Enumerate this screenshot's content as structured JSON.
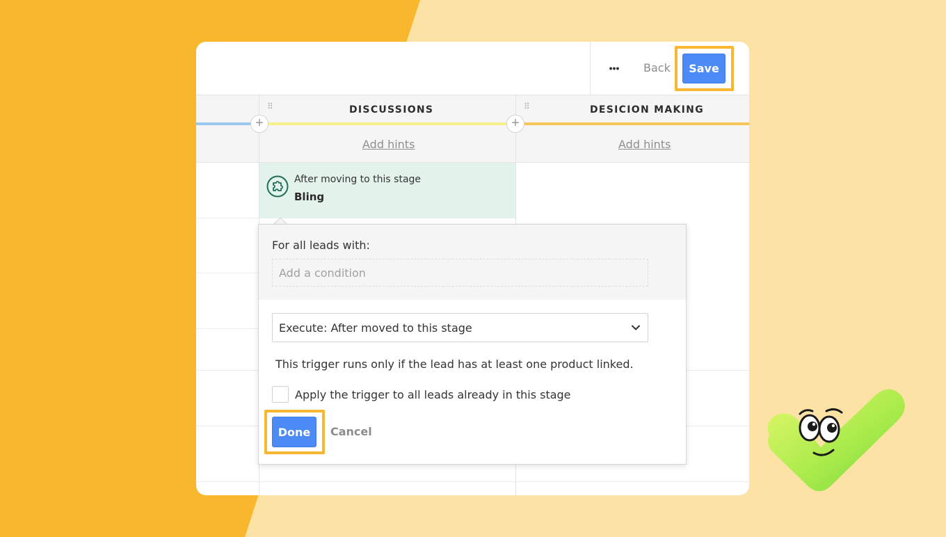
{
  "topbar": {
    "more_icon": "ellipsis-icon",
    "more_glyph": "•••",
    "back_label": "Back",
    "save_label": "Save"
  },
  "columns": [
    {
      "title": "DISCUSSIONS",
      "hints_label": "Add hints",
      "color": "#f5f08a"
    },
    {
      "title": "DESICION MAKING",
      "hints_label": "Add hints",
      "color": "#f7c55a"
    }
  ],
  "previous_stage_color": "#9cc8f0",
  "trigger": {
    "icon": "puzzle-piece-icon",
    "subtitle": "After moving to this stage",
    "name": "Bling"
  },
  "popover": {
    "leads_label": "For all leads with:",
    "condition_placeholder": "Add a condition",
    "execute_value": "Execute: After moved to this stage",
    "info_text": "This trigger runs only if the lead has at least one product linked.",
    "checkbox_label": "Apply the trigger to all leads already in this stage",
    "checkbox_checked": false,
    "done_label": "Done",
    "cancel_label": "Cancel"
  },
  "colors": {
    "accent_blue": "#4c8bf5",
    "highlight_yellow": "#f9b731",
    "trigger_bg": "#e3f3ec",
    "trigger_icon": "#1f6e58",
    "bg_orange": "#f9b72d",
    "bg_light": "#fce2a5"
  }
}
